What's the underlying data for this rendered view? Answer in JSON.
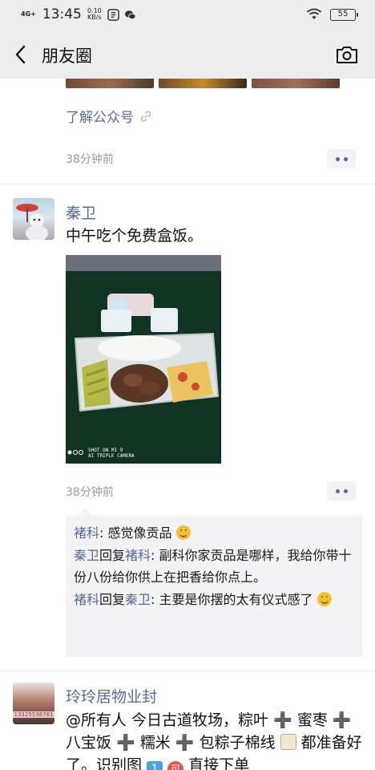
{
  "status_bar": {
    "network": "4G+",
    "time": "13:45",
    "speed_value": "0.10",
    "speed_unit": "KB/s",
    "battery": "55"
  },
  "nav": {
    "title": "朋友圈"
  },
  "prev_post": {
    "link_text": "了解公众号",
    "time": "38分钟前"
  },
  "post": {
    "author": "秦卫",
    "text": "中午吃个免费盒饭。",
    "photo_watermark_line1": "SHOT ON MI 9",
    "photo_watermark_line2": "AI TRIPLE CAMERA",
    "time": "38分钟前",
    "comments": [
      {
        "name": "褚科",
        "sep": ": ",
        "text": "感觉像贡品"
      },
      {
        "name": "秦卫",
        "reply_word": "回复",
        "reply_to": "褚科",
        "sep": ": ",
        "text": "副科你家贡品是哪样，我给你带十份八份给你供上在把香给你点上。"
      },
      {
        "name": "褚科",
        "reply_word": "回复",
        "reply_to": "秦卫",
        "sep": ": ",
        "text": "主要是你摆的太有仪式感了"
      }
    ]
  },
  "next_post": {
    "author": "玲玲居物业封",
    "avatar_phone": "13325538761",
    "text_p1": "@所有人   今日古道牧场，粽叶",
    "text_p2": "蜜枣",
    "text_p3": "八宝饭",
    "text_p4": "糯米",
    "text_p5": "包粽子棉线",
    "text_p6": "都准备好了。识别图",
    "text_p7": "直接下单"
  },
  "colors": {
    "link": "#576b95",
    "bar_bg": "#ededed",
    "comment_bg": "#f3f3f5",
    "time_gray": "#9a9a9a"
  },
  "icons": [
    "back-arrow-icon",
    "camera-icon",
    "link-icon",
    "more-dots-icon",
    "wifi-icon",
    "battery-icon",
    "emoji-smirk-icon"
  ]
}
